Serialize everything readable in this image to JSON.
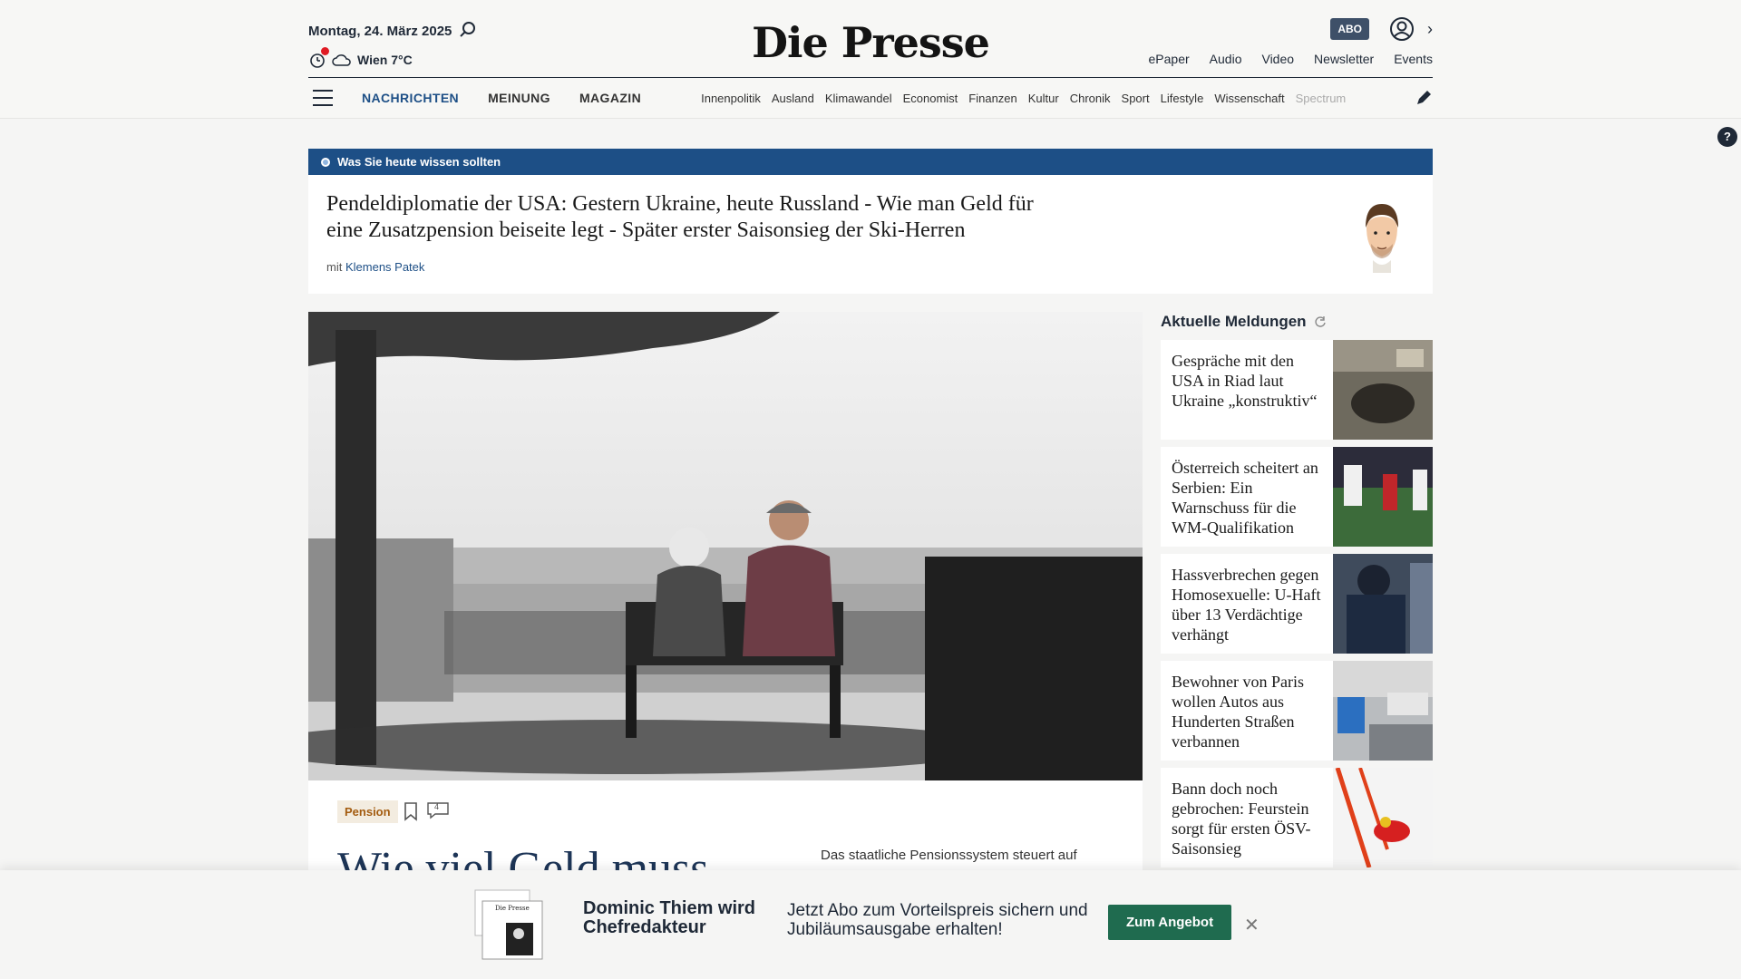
{
  "header": {
    "date": "Montag, 24. März 2025",
    "weather": "Wien 7°C",
    "logo": "Die Presse",
    "abo_label": "ABO",
    "top_links": [
      "ePaper",
      "Audio",
      "Video",
      "Newsletter",
      "Events"
    ],
    "main_nav": [
      "NACHRICHTEN",
      "MEINUNG",
      "MAGAZIN"
    ],
    "sub_nav": [
      "Innenpolitik",
      "Ausland",
      "Klimawandel",
      "Economist",
      "Finanzen",
      "Kultur",
      "Chronik",
      "Sport",
      "Lifestyle",
      "Wissenschaft",
      "Spectrum"
    ]
  },
  "briefing": {
    "label": "Was Sie heute wissen sollten",
    "title": "Pendeldiplomatie der USA: Gestern Ukraine, heute Russland - Wie man Geld für eine Zusatzpension beiseite legt - Später erster Saisonsieg der Ski-Herren",
    "author_prefix": "mit",
    "author": "Klemens Patek"
  },
  "hero": {
    "tag": "Pension",
    "comments": "4",
    "headline": "Wie viel Geld muss",
    "teaser": "Das staatliche Pensionssystem steuert auf"
  },
  "sidebar": {
    "title": "Aktuelle Meldungen",
    "items": [
      {
        "title": "Gespräche mit den USA in Riad laut Ukraine „konstruktiv“"
      },
      {
        "title": "Österreich scheitert an Serbien: Ein Warnschuss für die WM-Qualifikation"
      },
      {
        "title": "Hassverbrechen gegen Homosexuelle: U-Haft über 13 Verdächtige verhängt"
      },
      {
        "title": "Bewohner von Paris wollen Autos aus Hunderten Straßen verbannen"
      },
      {
        "title": "Bann doch noch gebrochen: Feurstein sorgt für ersten ÖSV-Saisonsieg"
      }
    ]
  },
  "banner": {
    "headline": "Dominic Thiem wird Chefredakteur",
    "text": "Jetzt Abo zum Vorteilspreis sichern und Jubiläumsausgabe erhalten!",
    "button": "Zum Angebot"
  },
  "colors": {
    "brand_blue": "#1d4f86",
    "abo_bg": "#3e5068",
    "cta_green": "#1f6b4f",
    "tag_text": "#a35b0f"
  }
}
